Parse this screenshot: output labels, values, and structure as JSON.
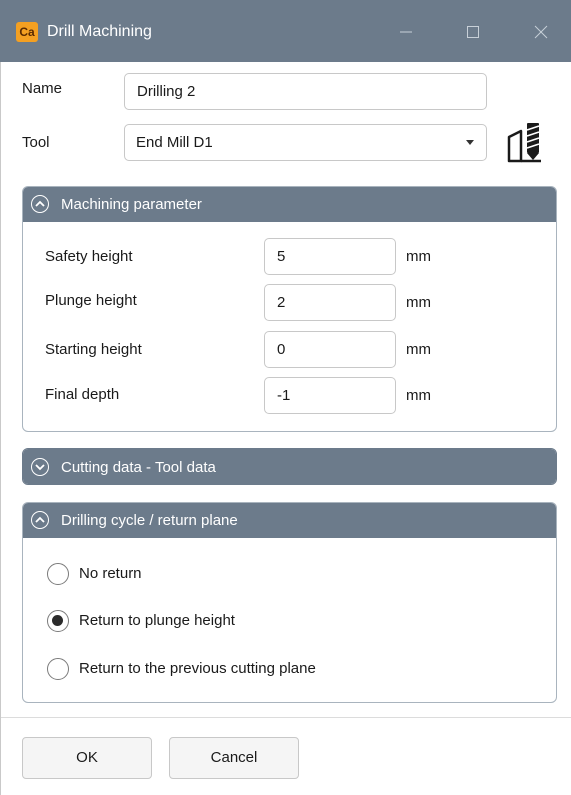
{
  "window": {
    "app_icon_text": "Ca",
    "title": "Drill Machining"
  },
  "form": {
    "name_label": "Name",
    "name_value": "Drilling 2",
    "tool_label": "Tool",
    "tool_value": "End Mill D1"
  },
  "machining": {
    "header": "Machining parameter",
    "rows": [
      {
        "label": "Safety height",
        "value": "5",
        "unit": "mm"
      },
      {
        "label": "Plunge height",
        "value": "2",
        "unit": "mm"
      },
      {
        "label": "Starting height",
        "value": "0",
        "unit": "mm"
      },
      {
        "label": "Final depth",
        "value": "-1",
        "unit": "mm"
      }
    ]
  },
  "cutting": {
    "header": "Cutting data - Tool data"
  },
  "drilling": {
    "header": "Drilling cycle / return plane",
    "options": [
      {
        "label": "No return",
        "checked": false
      },
      {
        "label": "Return to plunge height",
        "checked": true
      },
      {
        "label": "Return to the previous cutting plane",
        "checked": false
      }
    ]
  },
  "buttons": {
    "ok": "OK",
    "cancel": "Cancel"
  },
  "colors": {
    "title_bar": "#6c7b8b",
    "section_header": "#6c7b8b",
    "app_icon": "#f4a022"
  }
}
